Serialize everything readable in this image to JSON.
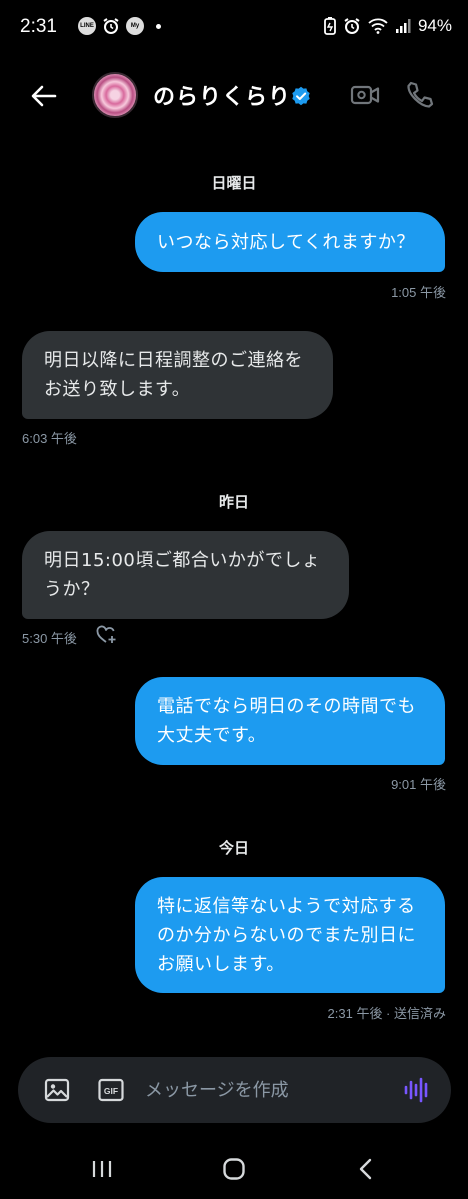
{
  "status_bar": {
    "time": "2:31",
    "battery": "94%",
    "left_icons": [
      "line-icon",
      "alarm-icon",
      "my-docomo-icon"
    ],
    "right_icons": [
      "battery-saver-icon",
      "alarm-icon",
      "wifi-icon",
      "signal-icon"
    ]
  },
  "header": {
    "contact_name": "のらりくらり",
    "verified": true,
    "icons": [
      "back-arrow-icon",
      "video-call-icon",
      "phone-icon"
    ]
  },
  "chat": {
    "date_sunday": "日曜日",
    "msg1": {
      "line1": "いつなら対応してくれますか？",
      "time": "1:05 午後"
    },
    "msg2": {
      "line1": "明日以降に日程調整のご連絡を",
      "line2": "お送り致します。",
      "time": "6:03 午後"
    },
    "date_yesterday": "昨日",
    "msg3": {
      "line1": "明日15:00頃ご都合いかがでしょ",
      "line2": "うか？",
      "time": "5:30 午後"
    },
    "msg4": {
      "line1": "電話でなら明日のその時間でも",
      "line2": "大丈夫です。",
      "time": "9:01 午後"
    },
    "date_today": "今日",
    "msg5": {
      "line1": "特に返信等ないようで対応する",
      "line2": "のか分からないのでまた別日に",
      "line3": "お願いします。",
      "time": "2:31 午後 · 送信済み"
    }
  },
  "composer": {
    "placeholder": "メッセージを作成",
    "gif_label": "GIF"
  },
  "colors": {
    "outgoing_bubble": "#1d9bf0",
    "incoming_bubble": "#2f3336",
    "voice_accent": "#7856ff",
    "background": "#000000"
  }
}
